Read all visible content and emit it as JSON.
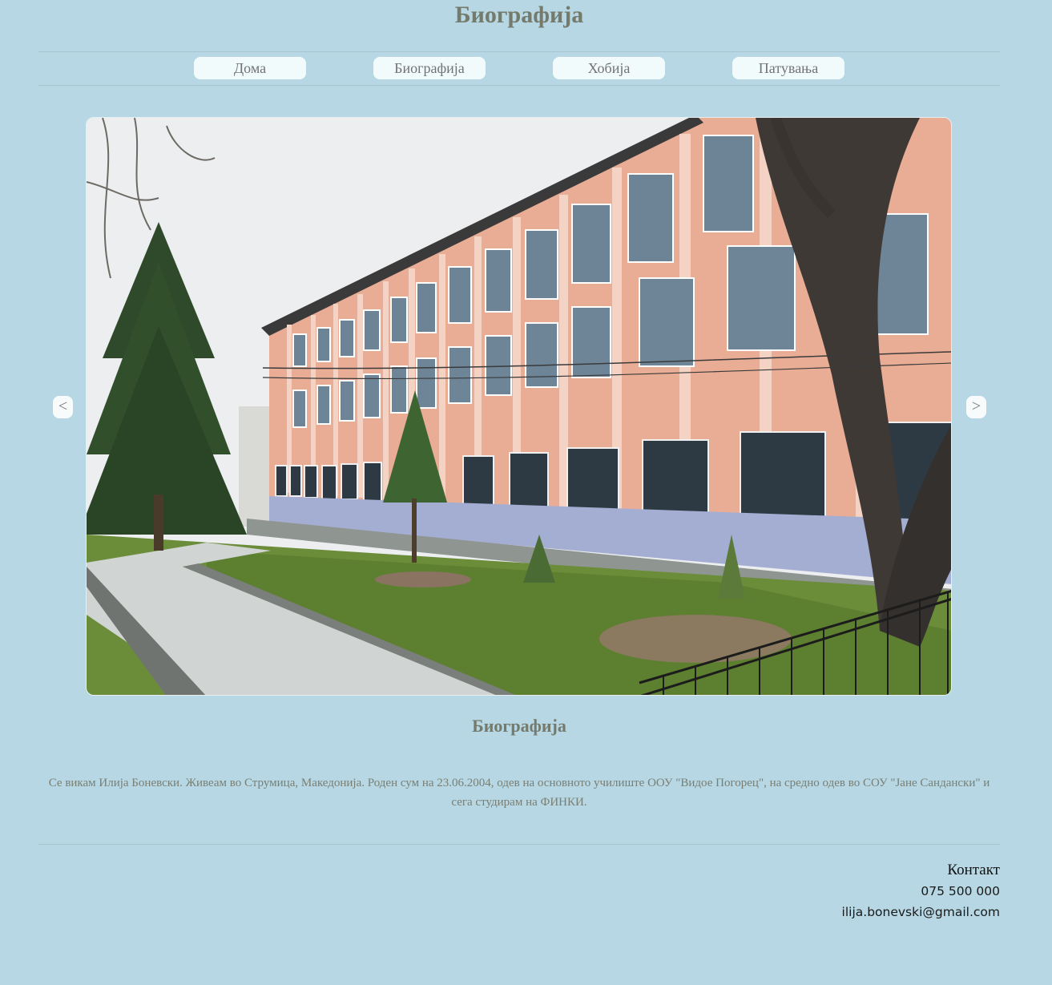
{
  "page": {
    "title": "Биографија"
  },
  "nav": {
    "items": [
      {
        "label": "Дома"
      },
      {
        "label": "Биографија"
      },
      {
        "label": "Хобија"
      },
      {
        "label": "Патувања"
      }
    ]
  },
  "slider": {
    "prev_label": "<",
    "next_label": ">",
    "image": "school-building-photo"
  },
  "bio": {
    "heading": "Биографија",
    "text": "Се викам Илија Боневски. Живеам во Струмица, Македонија. Роден сум на 23.06.2004, одев на основното училиште ООУ \"Видое Погорец\", на средно одев во СОУ \"Јане Сандански\" и сега студирам на ФИНКИ."
  },
  "contact": {
    "title": "Контакт",
    "phone": "075 500 000",
    "email": "ilija.bonevski@gmail.com"
  },
  "colors": {
    "background": "#b6d7e3",
    "nav_button": "#f1fbfb",
    "title_text": "#747a6c"
  }
}
